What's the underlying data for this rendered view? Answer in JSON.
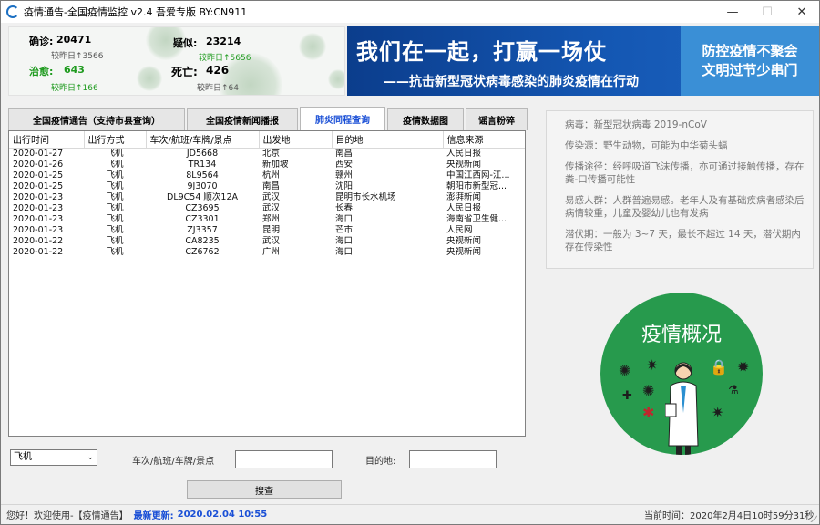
{
  "window": {
    "title": "疫情通告-全国疫情监控 v2.4  吾爱专版  BY:CN911",
    "buttons": {
      "minimize": "—",
      "maximize": "☐",
      "close": "✕"
    }
  },
  "stats": {
    "confirmed_label": "确诊:",
    "confirmed_value": "20471",
    "suspected_label": "疑似:",
    "suspected_value": "23214",
    "cured_label": "治愈:",
    "cured_value": "643",
    "dead_label": "死亡:",
    "dead_value": "426",
    "confirmed_delta": "较昨日↑3566",
    "suspected_delta": "较昨日↑5656",
    "cured_delta": "较昨日↑166",
    "dead_delta": "较昨日↑64"
  },
  "banner": {
    "main": "我们在一起，打赢一场仗",
    "sub": "——抗击新型冠状病毒感染的肺炎疫情在行动",
    "right_line1": "防控疫情不聚会",
    "right_line2": "文明过节少串门"
  },
  "tabs": [
    {
      "label": "全国疫情通告（支持市县查询）"
    },
    {
      "label": "全国疫情新闻播报"
    },
    {
      "label": "肺炎同程查询",
      "active": true
    },
    {
      "label": "疫情数据图"
    },
    {
      "label": "谣言粉碎"
    }
  ],
  "table": {
    "columns": [
      "出行时间",
      "出行方式",
      "车次/航班/车牌/景点",
      "出发地",
      "目的地",
      "信息来源"
    ],
    "rows": [
      [
        "2020-01-27",
        "飞机",
        "JD5668",
        "北京",
        "南昌",
        "人民日报"
      ],
      [
        "2020-01-26",
        "飞机",
        "TR134",
        "新加坡",
        "西安",
        "央视新闻"
      ],
      [
        "2020-01-25",
        "飞机",
        "8L9564",
        "杭州",
        "赣州",
        "中国江西网-江..."
      ],
      [
        "2020-01-25",
        "飞机",
        "9J3070",
        "南昌",
        "沈阳",
        "朝阳市新型冠..."
      ],
      [
        "2020-01-23",
        "飞机",
        "DL9C54  顺次12A",
        "武汉",
        "昆明市长水机场",
        "澎湃新闻"
      ],
      [
        "2020-01-23",
        "飞机",
        "CZ3695",
        "武汉",
        "长春",
        "人民日报"
      ],
      [
        "2020-01-23",
        "飞机",
        "CZ3301",
        "郑州",
        "海口",
        "海南省卫生健..."
      ],
      [
        "2020-01-23",
        "飞机",
        "ZJ3357",
        "昆明",
        "芒市",
        "人民网"
      ],
      [
        "2020-01-22",
        "飞机",
        "CA8235",
        "武汉",
        "海口",
        "央视新闻"
      ],
      [
        "2020-01-22",
        "飞机",
        "CZ6762",
        "广州",
        "海口",
        "央视新闻"
      ]
    ]
  },
  "controls": {
    "travel_mode_selected": "飞机",
    "vehicle_label": "车次/航班/车牌/景点",
    "destination_label": "目的地:",
    "query_button": "搜查"
  },
  "info": {
    "pathogen": "病毒：新型冠状病毒 2019-nCoV",
    "source": "传染源：野生动物，可能为中华菊头蝠",
    "route": "传播途径：经呼吸道飞沫传播，亦可通过接触传播，存在粪-口传播可能性",
    "susceptible": "易感人群：人群普遍易感。老年人及有基础疾病者感染后病情较重，儿童及婴幼儿也有发病",
    "incubation": "潜伏期：一般为 3~7 天，最长不超过 14 天，潜伏期内存在传染性"
  },
  "illustration": {
    "title": "疫情概况"
  },
  "status": {
    "greeting": "您好！欢迎使用-【疫情通告】",
    "update_label": "最新更新:",
    "update_time": "2020.02.04  10:55",
    "now": "当前时间：2020年2月4日10时59分31秒"
  },
  "colors": {
    "banner_blue": "#1457b3",
    "accent_blue": "#1a4fd6",
    "circle_green": "#279a4d",
    "stat_green": "#1f9b1f"
  }
}
